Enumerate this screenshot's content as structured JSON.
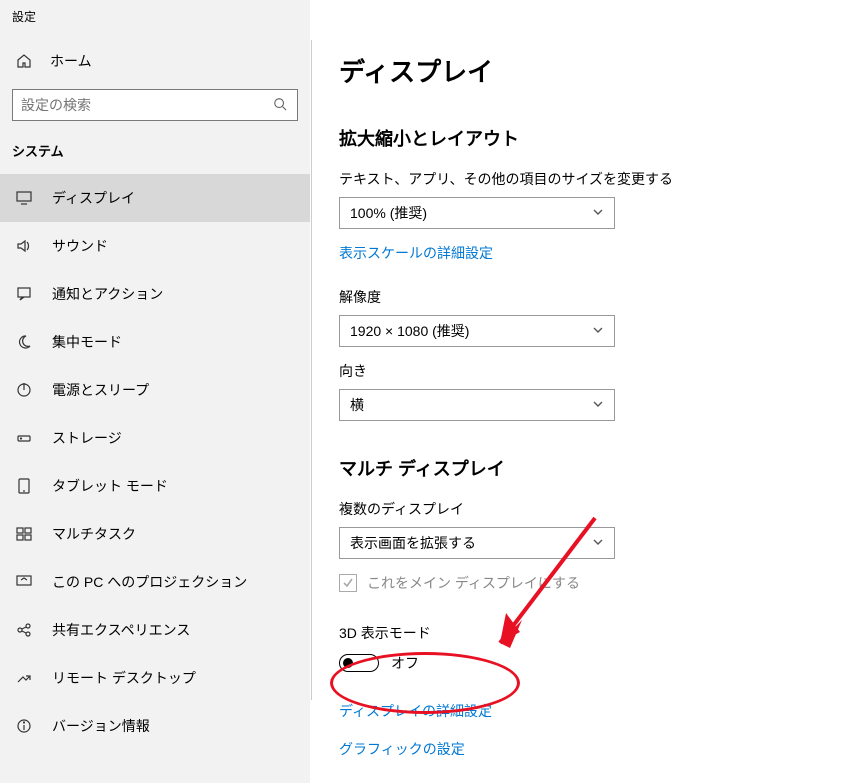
{
  "app_title": "設定",
  "home_label": "ホーム",
  "search": {
    "placeholder": "設定の検索"
  },
  "category_heading": "システム",
  "nav": [
    {
      "id": "display",
      "label": "ディスプレイ",
      "active": true
    },
    {
      "id": "sound",
      "label": "サウンド"
    },
    {
      "id": "notifications",
      "label": "通知とアクション"
    },
    {
      "id": "focus",
      "label": "集中モード"
    },
    {
      "id": "power",
      "label": "電源とスリープ"
    },
    {
      "id": "storage",
      "label": "ストレージ"
    },
    {
      "id": "tablet",
      "label": "タブレット モード"
    },
    {
      "id": "multitask",
      "label": "マルチタスク"
    },
    {
      "id": "project",
      "label": "この PC へのプロジェクション"
    },
    {
      "id": "shared",
      "label": "共有エクスペリエンス"
    },
    {
      "id": "remote",
      "label": "リモート デスクトップ"
    },
    {
      "id": "about",
      "label": "バージョン情報"
    }
  ],
  "page_title": "ディスプレイ",
  "section_scale_title": "拡大縮小とレイアウト",
  "scale_label": "テキスト、アプリ、その他の項目のサイズを変更する",
  "scale_value": "100% (推奨)",
  "scale_link": "表示スケールの詳細設定",
  "resolution_label": "解像度",
  "resolution_value": "1920 × 1080 (推奨)",
  "orientation_label": "向き",
  "orientation_value": "横",
  "section_multi_title": "マルチ ディスプレイ",
  "multi_label": "複数のディスプレイ",
  "multi_value": "表示画面を拡張する",
  "main_display_checkbox": "これをメイン ディスプレイにする",
  "mode3d_label": "3D 表示モード",
  "mode3d_state": "オフ",
  "advanced_link": "ディスプレイの詳細設定",
  "graphics_link": "グラフィックの設定"
}
